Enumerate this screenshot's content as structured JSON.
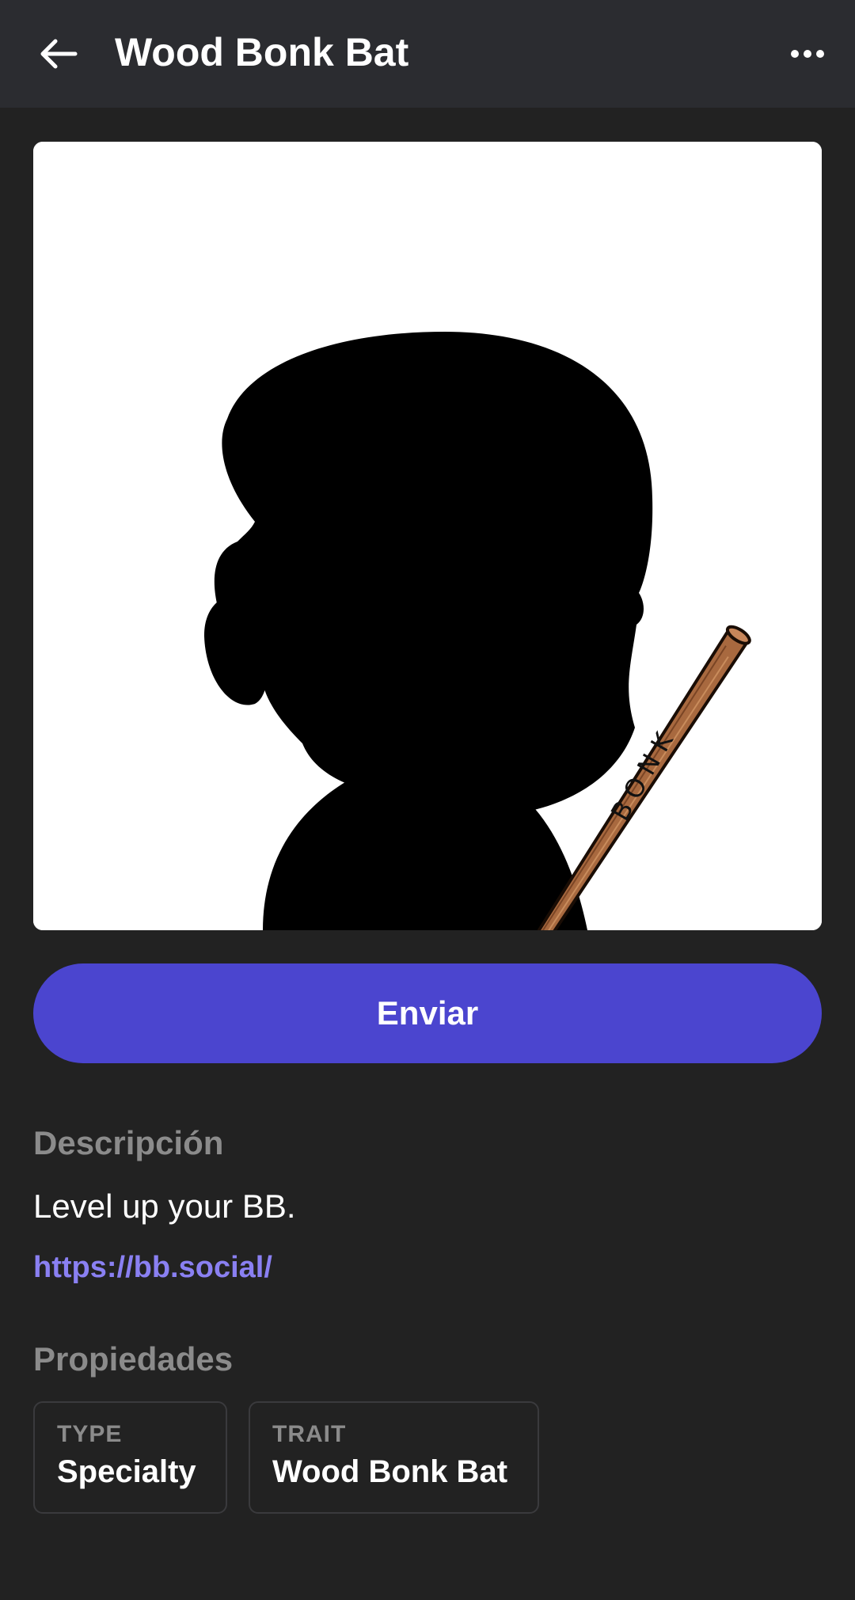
{
  "header": {
    "title": "Wood Bonk Bat",
    "back_icon": "arrow-left-icon",
    "more_icon": "more-horizontal-icon"
  },
  "artwork": {
    "bat_text": "BONK"
  },
  "actions": {
    "send_label": "Enviar"
  },
  "description": {
    "heading": "Descripción",
    "text": "Level up your BB.",
    "link": "https://bb.social/"
  },
  "properties": {
    "heading": "Propiedades",
    "items": [
      {
        "key": "TYPE",
        "value": "Specialty"
      },
      {
        "key": "TRAIT",
        "value": "Wood Bonk Bat"
      }
    ]
  },
  "colors": {
    "background": "#222222",
    "topbar": "#2b2c30",
    "accent": "#4b45cf",
    "link": "#8a80f2",
    "muted": "#8b8b8b"
  }
}
